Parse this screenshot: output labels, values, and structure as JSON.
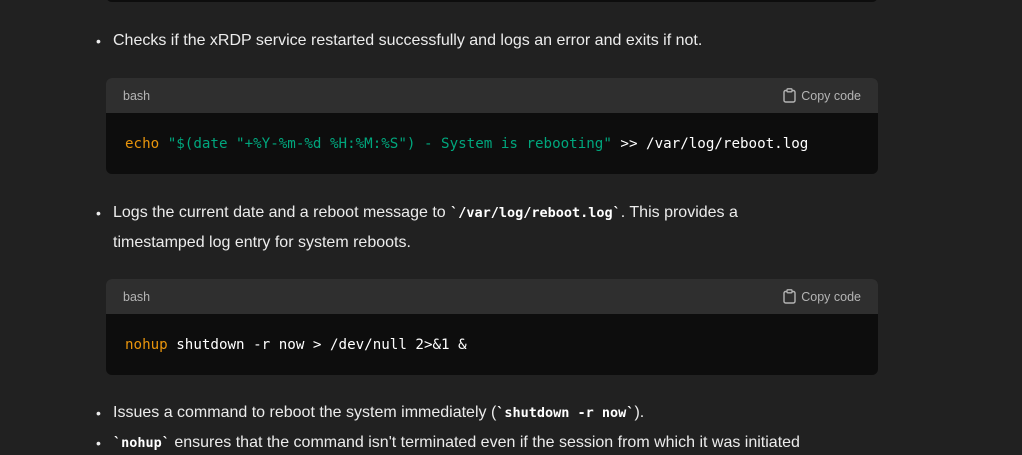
{
  "bullets": {
    "b1": "Checks if the xRDP service restarted successfully and logs an error and exits if not.",
    "b2_pre": "Logs the current date and a reboot message to ",
    "b2_code": "`/var/log/reboot.log`",
    "b2_post": ". This provides a",
    "b2_line2": "timestamped log entry for system reboots.",
    "b3_pre": "Issues a command to reboot the system immediately (",
    "b3_code": "`shutdown -r now`",
    "b3_post": ").",
    "b4_code": "`nohup`",
    "b4_post": " ensures that the command isn't terminated even if the session from which it was initiated"
  },
  "code_blocks": [
    {
      "language": "bash",
      "copy_label": "Copy code",
      "tokens": {
        "kw": "echo",
        "sp1": " ",
        "str": "\"$(date \"+%Y-%m-%d %H:%M:%S\") - System is rebooting\"",
        "rest": " >> /var/log/reboot.log"
      }
    },
    {
      "language": "bash",
      "copy_label": "Copy code",
      "tokens": {
        "kw": "nohup",
        "rest": " shutdown -r now > /dev/null 2>&1 &"
      }
    }
  ],
  "icons": {
    "bullet": "bullet-dot",
    "copy": "clipboard-icon"
  },
  "colors": {
    "background": "#212121",
    "code_bg": "#0d0d0d",
    "code_header_bg": "#2f2f2f",
    "keyword": "#e9950c",
    "string": "#00a67d"
  }
}
